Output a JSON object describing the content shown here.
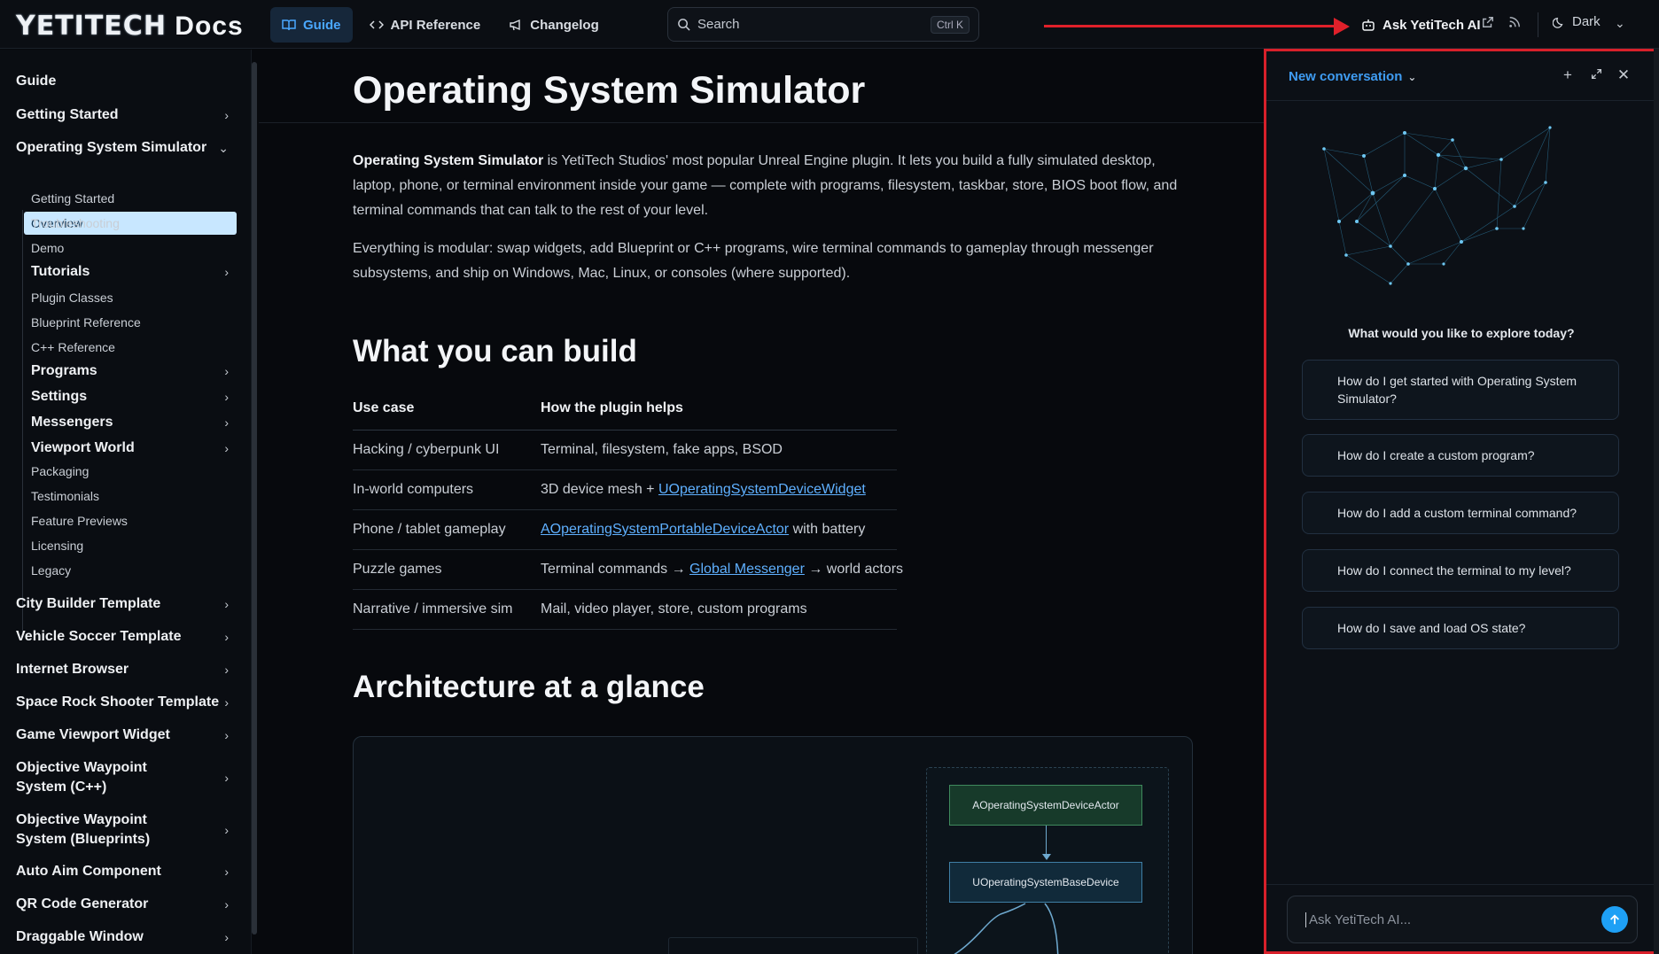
{
  "header": {
    "logo_text": "YETITECH",
    "logo_suffix": "Docs",
    "tabs": [
      {
        "label": "Guide",
        "icon": "book-icon"
      },
      {
        "label": "API Reference",
        "icon": "code-icon"
      },
      {
        "label": "Changelog",
        "icon": "megaphone-icon"
      }
    ],
    "search_placeholder": "Search",
    "search_shortcut": "Ctrl K",
    "ask_ai_label": "Ask YetiTech AI",
    "theme_label": "Dark"
  },
  "sidebar": {
    "top_items": [
      {
        "label": "Guide"
      },
      {
        "label": "Getting Started"
      },
      {
        "label": "Operating System Simulator"
      }
    ],
    "os_children": [
      {
        "label": "Overview"
      },
      {
        "label": "Getting Started"
      },
      {
        "label": "Troubleshooting"
      },
      {
        "label": "Demo"
      },
      {
        "label": "Tutorials"
      },
      {
        "label": "Plugin Classes"
      },
      {
        "label": "Blueprint Reference"
      },
      {
        "label": "C++ Reference"
      },
      {
        "label": "Programs"
      },
      {
        "label": "Settings"
      },
      {
        "label": "Messengers"
      },
      {
        "label": "Viewport World"
      },
      {
        "label": "Packaging"
      },
      {
        "label": "Testimonials"
      },
      {
        "label": "Feature Previews"
      },
      {
        "label": "Licensing"
      },
      {
        "label": "Legacy"
      }
    ],
    "bottom_items": [
      {
        "label": "City Builder Template"
      },
      {
        "label": "Vehicle Soccer Template"
      },
      {
        "label": "Internet Browser"
      },
      {
        "label": "Space Rock Shooter Template"
      },
      {
        "label": "Game Viewport Widget"
      },
      {
        "label": "Objective Waypoint System (C++)"
      },
      {
        "label": "Objective Waypoint System (Blueprints)"
      },
      {
        "label": "Auto Aim Component"
      },
      {
        "label": "QR Code Generator"
      },
      {
        "label": "Draggable Window"
      }
    ]
  },
  "main": {
    "title": "Operating System Simulator",
    "intro_bold": "Operating System Simulator",
    "intro_rest": " is YetiTech Studios' most popular Unreal Engine plugin. It lets you build a fully simulated desktop, laptop, phone, or terminal environment inside your game — complete with programs, filesystem, taskbar, store, BIOS boot flow, and terminal commands that can talk to the rest of your level.",
    "para2": "Everything is modular: swap widgets, add Blueprint or C++ programs, wire terminal commands to gameplay through messenger subsystems, and ship on Windows, Mac, Linux, or consoles (where supported).",
    "h2_build": "What you can build",
    "table": {
      "headers": [
        "Use case",
        "How the plugin helps"
      ],
      "rows": [
        {
          "use": "Hacking / cyberpunk UI",
          "pre": "Terminal, filesystem, fake apps, BSOD",
          "link": "",
          "post": ""
        },
        {
          "use": "In-world computers",
          "pre": "3D device mesh + ",
          "link": "UOperatingSystemDeviceWidget",
          "post": ""
        },
        {
          "use": "Phone / tablet gameplay",
          "pre": "",
          "link": "AOperatingSystemPortableDeviceActor",
          "post": " with battery"
        },
        {
          "use": "Puzzle games",
          "pre": "Terminal commands → ",
          "link": "Global Messenger",
          "post": " → world actors"
        },
        {
          "use": "Narrative / immersive sim",
          "pre": "Mail, video player, store, custom programs",
          "link": "",
          "post": ""
        }
      ]
    },
    "h2_arch": "Architecture at a glance",
    "diagram": {
      "node_device_actor": "AOperatingSystemDeviceActor",
      "node_base_device": "UOperatingSystemBaseDevice"
    }
  },
  "ai_panel": {
    "title": "New conversation",
    "question": "What would you like to explore today?",
    "suggestions": [
      "How do I get started with Operating System Simulator?",
      "How do I create a custom program?",
      "How do I add a custom terminal command?",
      "How do I connect the terminal to my level?",
      "How do I save and load OS state?"
    ],
    "input_placeholder": "Ask YetiTech AI..."
  },
  "colors": {
    "accent": "#4aa8ff",
    "highlight_border": "#d8202a",
    "send_button": "#1ea0f5"
  }
}
